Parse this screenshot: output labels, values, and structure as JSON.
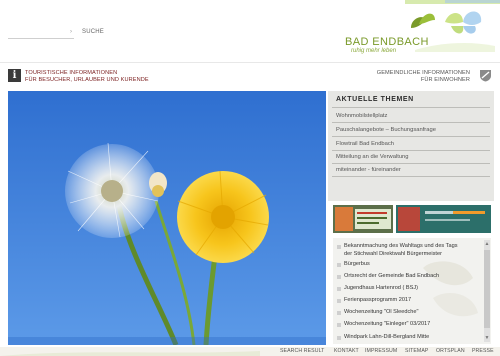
{
  "header": {
    "search_placeholder": "",
    "search_button": "SUCHE",
    "brand_title": "BAD ENDBACH",
    "brand_subtitle": "ruhig mehr leben"
  },
  "infobar": {
    "tourist_line1": "TOURISTISCHE INFORMATIONEN",
    "tourist_line2": "FÜR BESUCHER, URLAUBER UND KURENDE",
    "municipal_line1": "GEMEINDLICHE INFORMATIONEN",
    "municipal_line2": "FÜR EINWOHNER"
  },
  "topics": {
    "title": "AKTUELLE THEMEN",
    "items": [
      "Wohnmobilstellplatz",
      "Pauschalangebote – Buchungsanfrage",
      "Flowtrail Bad Endbach",
      "Mitteilung an die Verwaltung",
      "miteinander - füreinander"
    ]
  },
  "news": {
    "items": [
      "Bekanntmachung des Wahltags und des Tags",
      "der Stichwahl Direktwahl Bürgermeister",
      "Bürgerbus",
      "Ortsrecht der Gemeinde Bad Endbach",
      "Jugendhaus Hartenrod ( BSJ)",
      "Ferienpassprogramm 2017",
      "Wochenzeitung \"Ol Sleedche\"",
      "Wochenzeitung \"Einleger\" 03/2017",
      "Windpark Lahn-Dill-Bergland Mitte"
    ]
  },
  "footer": {
    "links": [
      "SEARCH RESULT",
      "KONTAKT",
      "IMPRESSUM",
      "SITEMAP",
      "ORTSPLAN",
      "PRESSE"
    ]
  },
  "colors": {
    "brand_green": "#7a9a2a",
    "info_red": "#7a1e1e",
    "sky_blue": "#3f7fd6",
    "panel_grey": "#e7e7e4"
  }
}
